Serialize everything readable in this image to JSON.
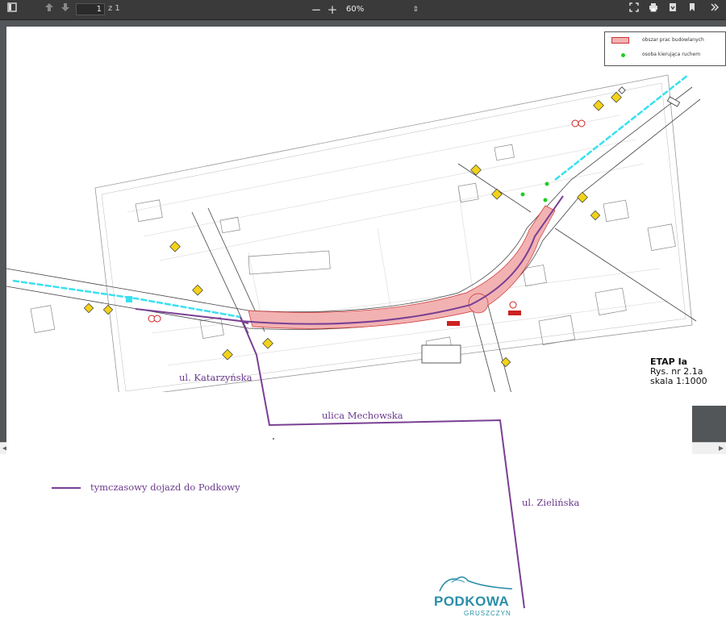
{
  "toolbar": {
    "page_current": "1",
    "page_total": "z 1",
    "zoom": "60%",
    "icons": [
      "sidebar-toggle-icon",
      "arrow-up-icon",
      "arrow-down-icon",
      "minus-icon",
      "plus-icon",
      "fit-page-icon",
      "print-icon",
      "download-icon",
      "bookmark-icon",
      "more-icon"
    ],
    "minus_label": "−",
    "plus_label": "+"
  },
  "map": {
    "legend": {
      "work_area": "obszar prac budowlanych",
      "traffic_person": "osoba kierująca ruchem"
    },
    "etap_title": "ETAP Ia",
    "drawing_no": "Rys. nr 2.1a",
    "scale": "skala 1:1000"
  },
  "annotations": {
    "street_katarzynska": "ul. Katarzyńska",
    "street_mechowska": "ulica Mechowska",
    "street_zielinska": "ul. Zielińska",
    "route_legend": "tymczasowy dojazd do Podkowy"
  },
  "logo": {
    "name": "PODKOWA",
    "sub": "GRUSZCZYN"
  },
  "colors": {
    "route": "#7a3f94",
    "work_area": "#f2b2b2",
    "cyan_road": "#39e0f0",
    "logo": "#2a8fa8"
  }
}
